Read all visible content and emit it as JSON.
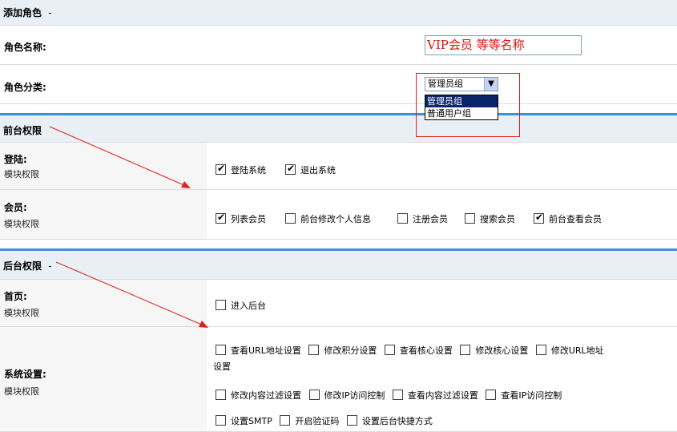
{
  "sections": {
    "add_role": "添加角色",
    "front_perm": "前台权限",
    "back_perm": "后台权限",
    "dash": "-"
  },
  "role_name": {
    "label": "角色名称:",
    "value": "VIP会员 等等名称"
  },
  "role_type": {
    "label": "角色分类:",
    "selected": "管理员组",
    "options": [
      "管理员组",
      "普通用户组"
    ]
  },
  "module_perm": "模块权限",
  "front": {
    "login": {
      "label": "登陆:",
      "items": [
        {
          "label": "登陆系统",
          "checked": true
        },
        {
          "label": "退出系统",
          "checked": true
        }
      ]
    },
    "member": {
      "label": "会员:",
      "items": [
        {
          "label": "列表会员",
          "checked": true
        },
        {
          "label": "前台修改个人信息",
          "checked": false
        },
        {
          "label": "注册会员",
          "checked": false
        },
        {
          "label": "搜索会员",
          "checked": false
        },
        {
          "label": "前台查看会员",
          "checked": true
        }
      ]
    }
  },
  "back": {
    "home": {
      "label": "首页:",
      "items": [
        {
          "label": "进入后台",
          "checked": false
        }
      ]
    },
    "system": {
      "label": "系统设置:",
      "row1": [
        {
          "label": "查看URL地址设置",
          "checked": false
        },
        {
          "label": "修改积分设置",
          "checked": false
        },
        {
          "label": "查看核心设置",
          "checked": false
        },
        {
          "label": "修改核心设置",
          "checked": false
        },
        {
          "label": "修改URL地址",
          "checked": false
        }
      ],
      "wrap": "设置",
      "row2": [
        {
          "label": "修改内容过滤设置",
          "checked": false
        },
        {
          "label": "修改IP访问控制",
          "checked": false
        },
        {
          "label": "查看内容过滤设置",
          "checked": false
        },
        {
          "label": "查看IP访问控制",
          "checked": false
        }
      ],
      "row3": [
        {
          "label": "设置SMTP",
          "checked": false
        },
        {
          "label": "开启验证码",
          "checked": false
        },
        {
          "label": "设置后台快捷方式",
          "checked": false
        }
      ]
    }
  },
  "colors": {
    "header_bg": "#e8f0f6",
    "section_line": "#3d8fd6",
    "annotation_red": "#e02020",
    "input_text": "#e01010"
  }
}
